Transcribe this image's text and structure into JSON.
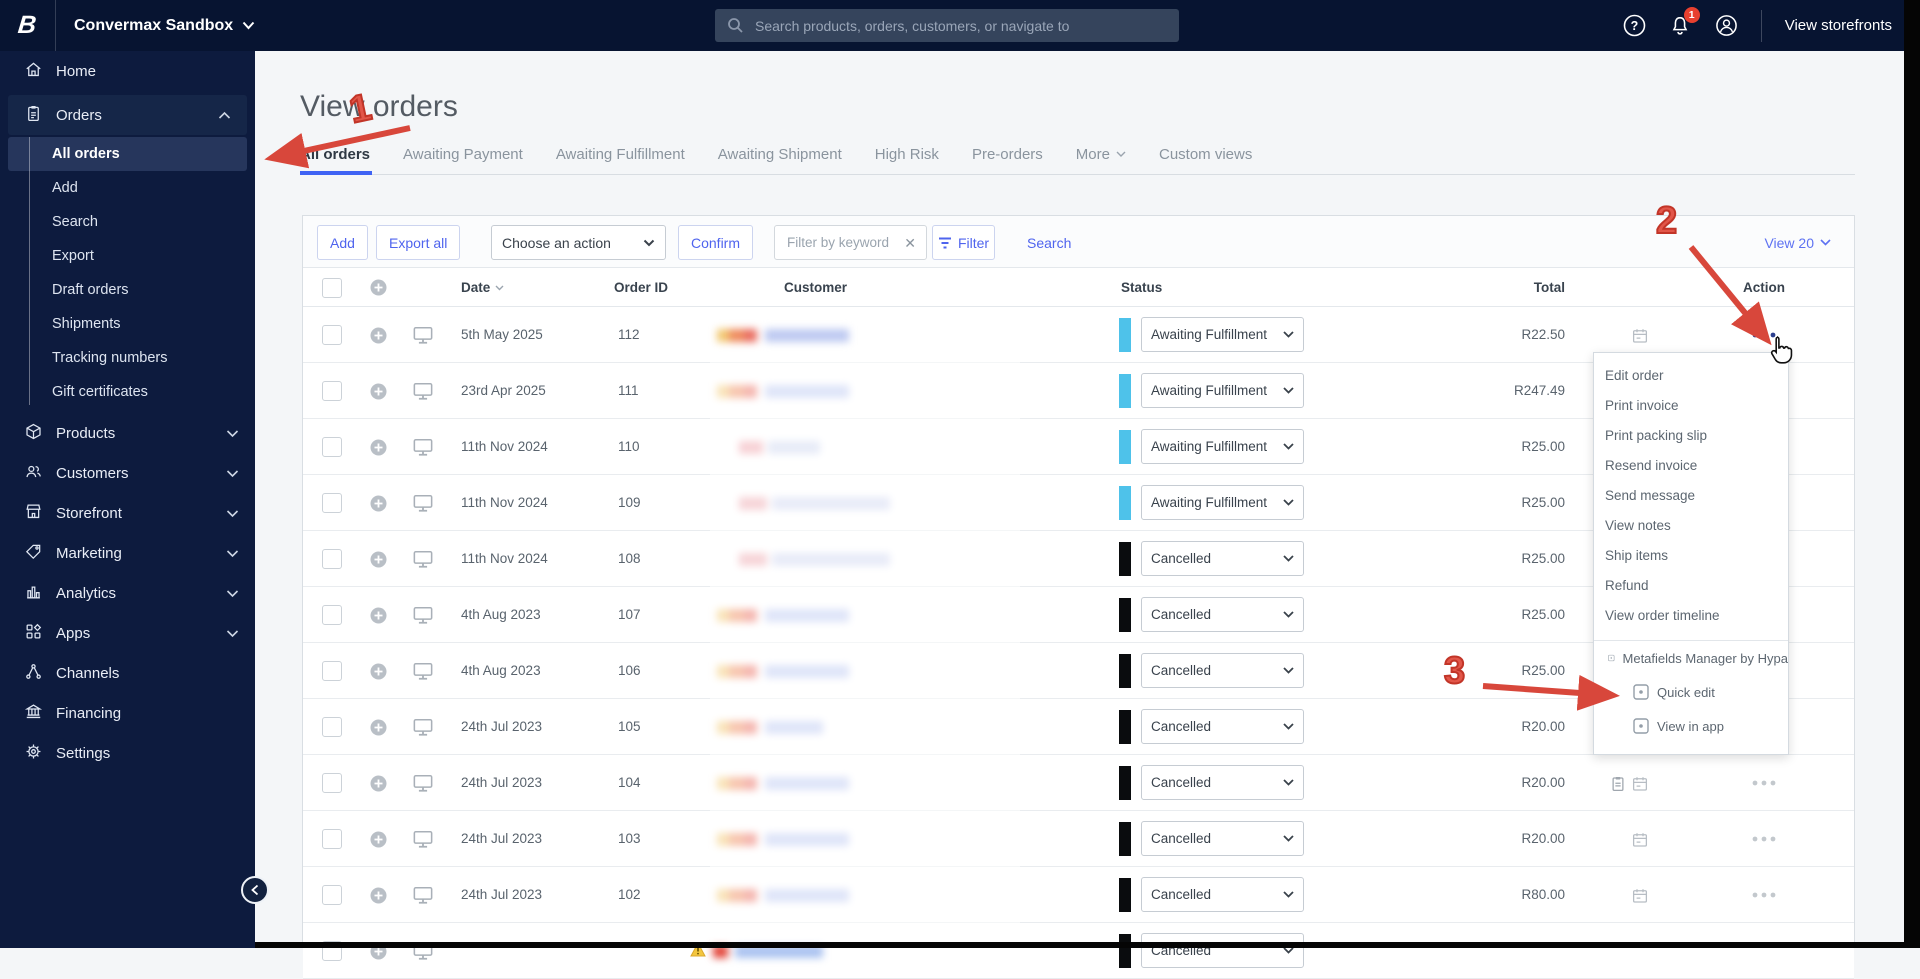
{
  "topbar": {
    "store_name": "Convermax Sandbox",
    "search_placeholder": "Search products, orders, customers, or navigate to",
    "notification_count": "1",
    "view_storefronts_label": "View storefronts"
  },
  "sidebar": {
    "items": [
      {
        "label": "Home",
        "icon": "home"
      },
      {
        "label": "Orders",
        "icon": "orders",
        "chevron": "up",
        "expanded": true,
        "children": [
          "All orders",
          "Add",
          "Search",
          "Export",
          "Draft orders",
          "Shipments",
          "Tracking numbers",
          "Gift certificates"
        ],
        "active_child": "All orders"
      },
      {
        "label": "Products",
        "icon": "products",
        "chevron": "down"
      },
      {
        "label": "Customers",
        "icon": "customers",
        "chevron": "down"
      },
      {
        "label": "Storefront",
        "icon": "storefront",
        "chevron": "down"
      },
      {
        "label": "Marketing",
        "icon": "marketing",
        "chevron": "down"
      },
      {
        "label": "Analytics",
        "icon": "analytics",
        "chevron": "down"
      },
      {
        "label": "Apps",
        "icon": "apps",
        "chevron": "down"
      },
      {
        "label": "Channels",
        "icon": "channels"
      },
      {
        "label": "Financing",
        "icon": "financing"
      },
      {
        "label": "Settings",
        "icon": "settings"
      }
    ]
  },
  "page": {
    "title": "View orders"
  },
  "tabs": [
    {
      "label": "All orders",
      "active": true
    },
    {
      "label": "Awaiting Payment"
    },
    {
      "label": "Awaiting Fulfillment"
    },
    {
      "label": "Awaiting Shipment"
    },
    {
      "label": "High Risk"
    },
    {
      "label": "Pre-orders"
    },
    {
      "label": "More",
      "chevron": true
    },
    {
      "label": "Custom views"
    }
  ],
  "toolbar": {
    "add": "Add",
    "export_all": "Export all",
    "action_select": "Choose an action",
    "confirm": "Confirm",
    "filter_placeholder": "Filter by keyword",
    "filter": "Filter",
    "search": "Search",
    "view_count": "View 20"
  },
  "table": {
    "headers": {
      "date": "Date",
      "order_id": "Order ID",
      "customer": "Customer",
      "status": "Status",
      "total": "Total",
      "action": "Action"
    },
    "rows": [
      {
        "date": "5th May 2025",
        "id": "112",
        "status": "Awaiting Fulfillment",
        "status_color": "blue",
        "total": "R22.50",
        "customer": "(redacted)",
        "blur": "warm",
        "icons": [
          "calendar"
        ],
        "action": "dark"
      },
      {
        "date": "23rd Apr 2025",
        "id": "111",
        "status": "Awaiting Fulfillment",
        "status_color": "blue",
        "total": "R247.49",
        "customer": "(redacted)",
        "blur": "warm",
        "icons": [
          "calendar"
        ],
        "action": "gray"
      },
      {
        "date": "11th Nov 2024",
        "id": "110",
        "status": "Awaiting Fulfillment",
        "status_color": "blue",
        "total": "R25.00",
        "customer": "(redacted)",
        "blur": "pink-short",
        "icons": [
          "calendar"
        ],
        "action": "gray"
      },
      {
        "date": "11th Nov 2024",
        "id": "109",
        "status": "Awaiting Fulfillment",
        "status_color": "blue",
        "total": "R25.00",
        "customer": "(redacted)",
        "blur": "pink-long",
        "icons": [
          "calendar"
        ],
        "action": "gray"
      },
      {
        "date": "11th Nov 2024",
        "id": "108",
        "status": "Cancelled",
        "status_color": "black",
        "total": "R25.00",
        "customer": "(redacted)",
        "blur": "pink-long",
        "icons": [
          "calendar"
        ],
        "action": "gray"
      },
      {
        "date": "4th Aug 2023",
        "id": "107",
        "status": "Cancelled",
        "status_color": "black",
        "total": "R25.00",
        "customer": "(redacted)",
        "blur": "warm",
        "icons": [
          "calendar"
        ],
        "action": "gray"
      },
      {
        "date": "4th Aug 2023",
        "id": "106",
        "status": "Cancelled",
        "status_color": "black",
        "total": "R25.00",
        "customer": "(redacted)",
        "blur": "warm",
        "icons": [
          "calendar"
        ],
        "action": "gray"
      },
      {
        "date": "24th Jul 2023",
        "id": "105",
        "status": "Cancelled",
        "status_color": "black",
        "total": "R20.00",
        "customer": "(redacted)",
        "blur": "warm-short",
        "icons": [
          "calendar"
        ],
        "action": "gray"
      },
      {
        "date": "24th Jul 2023",
        "id": "104",
        "status": "Cancelled",
        "status_color": "black",
        "total": "R20.00",
        "customer": "(redacted)",
        "blur": "warm",
        "icons": [
          "note",
          "calendar"
        ],
        "action": "gray"
      },
      {
        "date": "24th Jul 2023",
        "id": "103",
        "status": "Cancelled",
        "status_color": "black",
        "total": "R20.00",
        "customer": "(redacted)",
        "blur": "warm",
        "icons": [
          "calendar"
        ],
        "action": "gray"
      },
      {
        "date": "24th Jul 2023",
        "id": "102",
        "status": "Cancelled",
        "status_color": "black",
        "total": "R80.00",
        "customer": "(redacted)",
        "blur": "warm",
        "icons": [
          "calendar"
        ],
        "action": "gray"
      },
      {
        "date": "",
        "id": "",
        "status": "Cancelled",
        "status_color": "black",
        "total": "",
        "customer": "(redacted)",
        "blur": "warning",
        "icons": [],
        "action": null,
        "partial": true
      }
    ]
  },
  "context_menu": {
    "items": [
      "Edit order",
      "Print invoice",
      "Print packing slip",
      "Resend invoice",
      "Send message",
      "View notes",
      "Ship items",
      "Refund",
      "View order timeline"
    ],
    "app_items": [
      {
        "label": "Metafields Manager by Hypa",
        "indent": false
      },
      {
        "label": "Quick edit",
        "indent": true
      },
      {
        "label": "View in app",
        "indent": true
      }
    ]
  },
  "annotations": {
    "num1": "1",
    "num2": "2",
    "num3": "3"
  },
  "colors": {
    "accent": "#3f63f4",
    "link_blue": "#4f64ee",
    "badge_red": "#e8402f",
    "annotation_red": "#d8473b",
    "status": {
      "blue": "#4ec2ea",
      "black": "#0a0c0e"
    }
  }
}
